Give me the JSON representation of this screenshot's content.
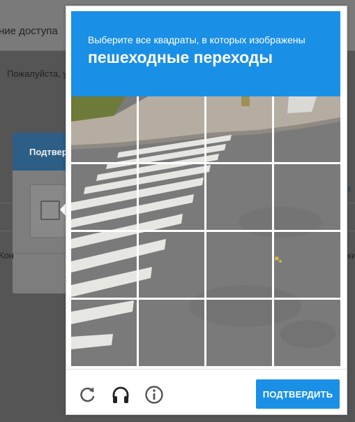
{
  "background": {
    "header_title": "ние доступа",
    "body_text": "Пожалуйста, у",
    "modal_title": "Подтвер",
    "footer_left_text": "Кон",
    "right_link_text": "а",
    "right_text": "ки"
  },
  "captcha": {
    "instruction": "Выберите все квадраты, в которых изображены",
    "target": "пешеходные переходы",
    "grid_rows": 4,
    "grid_cols": 4,
    "verify_label": "ПОДТВЕРДИТЬ",
    "icons": [
      "reload-icon",
      "audio-headphones-icon",
      "info-icon"
    ],
    "accent_color": "#1a8fe6"
  }
}
